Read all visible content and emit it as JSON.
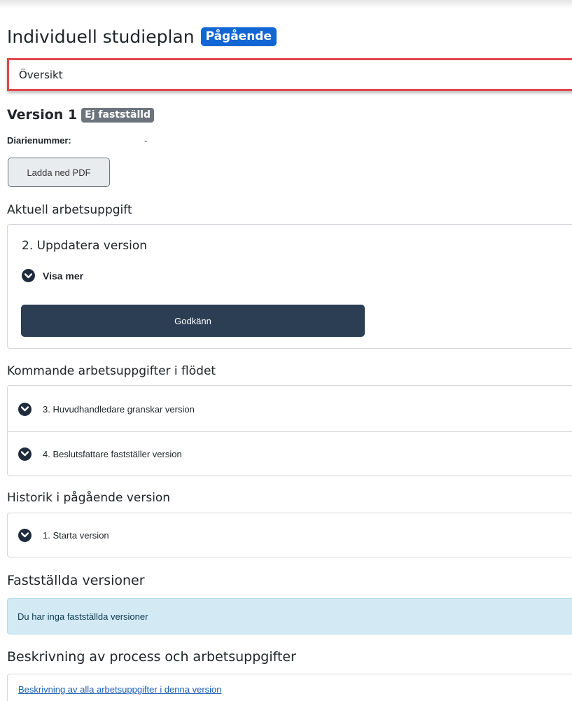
{
  "header": {
    "title": "Individuell studieplan",
    "status_badge": "Pågående"
  },
  "nav": {
    "selected_label": "Översikt"
  },
  "version": {
    "title": "Version 1",
    "status_badge": "Ej fastställd",
    "diarie_label": "Diarienummer:",
    "diarie_value": "-",
    "download_pdf_label": "Ladda ned PDF"
  },
  "current_task": {
    "heading": "Aktuell arbetsuppgift",
    "task_title": "2. Uppdatera version",
    "show_more_label": "Visa mer",
    "approve_label": "Godkänn"
  },
  "upcoming": {
    "heading": "Kommande arbetsuppgifter i flödet",
    "items": [
      {
        "label": "3. Huvudhandledare granskar version"
      },
      {
        "label": "4. Beslutsfattare fastställer version"
      }
    ]
  },
  "history": {
    "heading": "Historik i pågående version",
    "items": [
      {
        "label": "1. Starta version"
      }
    ]
  },
  "established": {
    "heading": "Fastställda versioner",
    "empty_message": "Du har inga fastställda versioner"
  },
  "description": {
    "heading": "Beskrivning av process och arbetsuppgifter",
    "link_label": "Beskrivning av alla arbetsuppgifter i denna version"
  },
  "colors": {
    "primary_badge": "#1266d4",
    "secondary_badge": "#6c757d",
    "highlight_border": "#e0474c",
    "dark_button": "#2b3e54",
    "info_background": "#d3eaf5",
    "link": "#1a5fb4"
  },
  "icons": {
    "expand": "chevron-down-circle-icon"
  }
}
